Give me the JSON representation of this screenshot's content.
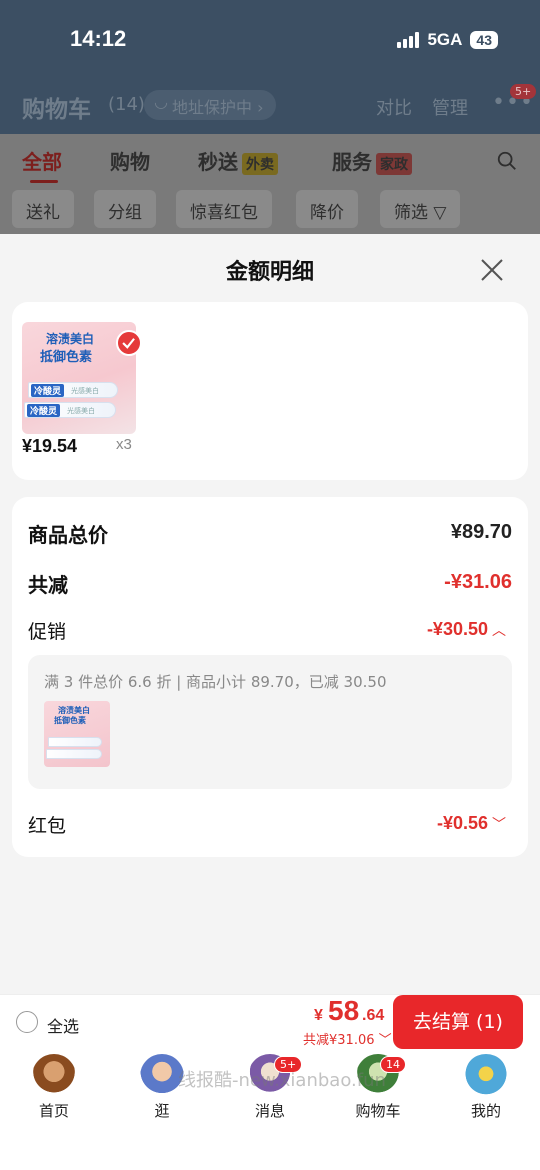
{
  "status_bar": {
    "time": "14:12",
    "network": "5GA",
    "battery": "43"
  },
  "background_page": {
    "title": "购物车",
    "count": "(14)",
    "address_protection": "地址保护中",
    "compare": "对比",
    "manage": "管理",
    "more_badge": "5+",
    "tabs": [
      {
        "label": "全部"
      },
      {
        "label": "购物"
      },
      {
        "label": "秒送",
        "tag": "外卖"
      },
      {
        "label": "服务",
        "tag": "家政"
      }
    ],
    "chips": [
      "送礼",
      "分组",
      "惊喜红包",
      "降价",
      "筛选"
    ]
  },
  "sheet": {
    "title": "金额明细",
    "product": {
      "image_text_1": "溶渍美白",
      "image_text_2": "抵御色素",
      "brand": "冷酸灵",
      "sub": "光感美白",
      "price": "¥19.54",
      "quantity": "x3"
    },
    "rows": {
      "goods_total_label": "商品总价",
      "goods_total_value": "¥89.70",
      "total_reduce_label": "共减",
      "total_reduce_value": "-¥31.06",
      "promotion_label": "促销",
      "promotion_value": "-¥30.50",
      "promotion_detail": "满 3 件总价 6.6 折 | 商品小计 89.70，已减 30.50",
      "red_packet_label": "红包",
      "red_packet_value": "-¥0.56"
    }
  },
  "checkout": {
    "select_all": "全选",
    "yen": "¥",
    "total_int": "58",
    "total_dec": ".64",
    "reduce_text": "共减¥31.06",
    "button": "去结算 (1)"
  },
  "tabbar": {
    "items": [
      {
        "label": "首页"
      },
      {
        "label": "逛"
      },
      {
        "label": "消息",
        "badge": "5+"
      },
      {
        "label": "购物车",
        "badge": "14"
      },
      {
        "label": "我的"
      }
    ],
    "watermark": "线报酷-new.xianbao.fun"
  },
  "colors": {
    "accent_red": "#e0302d",
    "header_dim": "#3c4f63"
  }
}
